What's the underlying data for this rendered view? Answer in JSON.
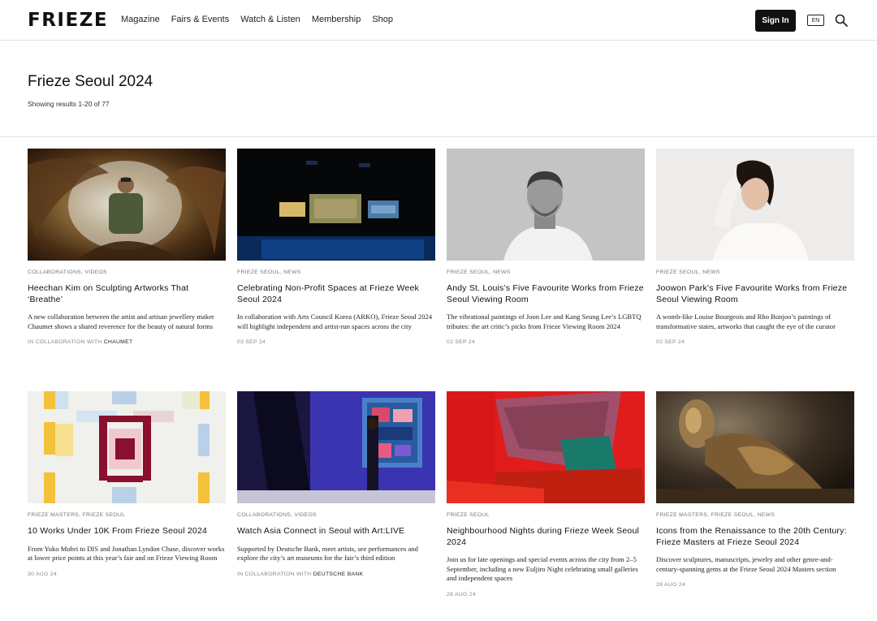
{
  "header": {
    "logo": "FRIEZE",
    "nav": [
      "Magazine",
      "Fairs & Events",
      "Watch & Listen",
      "Membership",
      "Shop"
    ],
    "sign_in": "Sign In",
    "lang": "EN"
  },
  "page": {
    "title": "Frieze Seoul 2024",
    "results": "Showing results 1-20 of 77"
  },
  "cards": [
    {
      "tags": "COLLABORATIONS, VIDEOS",
      "title": "Heechan Kim on Sculpting Artworks That ‘Breathe’",
      "desc": "A new collaboration between the artist and artisan jewellery maker Chaumet shows a shared reverence for the beauty of natural forms",
      "meta_prefix": "IN COLLABORATION WITH ",
      "meta_partner": "CHAUMET"
    },
    {
      "tags": "FRIEZE SEOUL, NEWS",
      "title": "Celebrating Non-Profit Spaces at Frieze Week Seoul 2024",
      "desc": "In collaboration with Arts Council Korea (ARKO), Frieze Seoul 2024 will highlight independent and artist-run spaces across the city",
      "meta_prefix": "03 SEP 24",
      "meta_partner": ""
    },
    {
      "tags": "FRIEZE SEOUL, NEWS",
      "title": "Andy St. Louis’s Five Favourite Works from Frieze Seoul Viewing Room",
      "desc": "The vibrational paintings of Joon Lee and Kang Seung Lee’s LGBTQ tributes: the art critic’s picks from Frieze Viewing Room 2024",
      "meta_prefix": "02 SEP 24",
      "meta_partner": ""
    },
    {
      "tags": "FRIEZE SEOUL, NEWS",
      "title": "Joowon Park’s Five Favourite Works from Frieze Seoul Viewing Room",
      "desc": "A womb-like Louise Bourgeois and Rho Bunjoo’s paintings of transformative states, artworks that caught the eye of the curator",
      "meta_prefix": "02 SEP 24",
      "meta_partner": ""
    },
    {
      "tags": "FRIEZE MASTERS, FRIEZE SEOUL",
      "title": "10 Works Under 10K From Frieze Seoul 2024",
      "desc": "From Yuko Mohri to DIS and Jonathan Lyndon Chase, discover works at lower price points at this year’s fair and on Frieze Viewing Room",
      "meta_prefix": "30 AUG 24",
      "meta_partner": ""
    },
    {
      "tags": "COLLABORATIONS, VIDEOS",
      "title": "Watch Asia Connect in Seoul with Art:LIVE",
      "desc": "Supported by Deutsche Bank, meet artists, see performances and explore the city’s art museums for the fair’s third edition",
      "meta_prefix": "IN COLLABORATION WITH ",
      "meta_partner": "DEUTSCHE BANK"
    },
    {
      "tags": "FRIEZE SEOUL",
      "title": "Neighbourhood Nights during Frieze Week Seoul 2024",
      "desc": "Join us for late openings and special events across the city from 2–5 September, including a new Euljiro Night celebrating small galleries and independent spaces",
      "meta_prefix": "28 AUG 24",
      "meta_partner": ""
    },
    {
      "tags": "FRIEZE MASTERS, FRIEZE SEOUL, NEWS",
      "title": "Icons from the Renaissance to the 20th Century: Frieze Masters at Frieze Seoul 2024",
      "desc": "Discover sculptures, manuscripts, jewelry and other genre-and-century-spanning gems at the Frieze Seoul 2024 Masters section",
      "meta_prefix": "28 AUG 24",
      "meta_partner": ""
    }
  ]
}
